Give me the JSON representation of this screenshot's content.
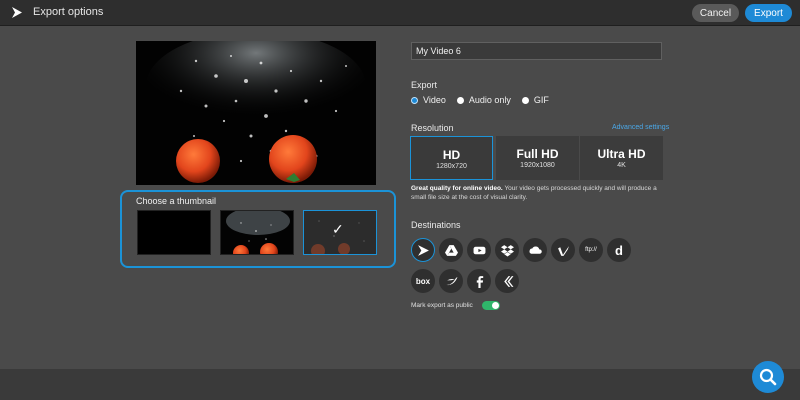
{
  "header": {
    "title": "Export options",
    "cancel_label": "Cancel",
    "export_label": "Export"
  },
  "thumbnails": {
    "title": "Choose a thumbnail",
    "selected_index": 2
  },
  "video_name": {
    "value": "My Video 6"
  },
  "export": {
    "label": "Export",
    "options": [
      "Video",
      "Audio only",
      "GIF"
    ],
    "selected": "Video"
  },
  "resolution": {
    "label": "Resolution",
    "advanced_link": "Advanced settings",
    "cards": [
      {
        "name": "HD",
        "sub": "1280x720"
      },
      {
        "name": "Full HD",
        "sub": "1920x1080"
      },
      {
        "name": "Ultra HD",
        "sub": "4K"
      }
    ],
    "selected": "HD",
    "description_bold": "Great quality for online video.",
    "description_rest": " Your video gets processed quickly and will produce a small file size at the cost of visual clarity."
  },
  "destinations": {
    "label": "Destinations",
    "items": [
      "wevideo-icon",
      "google-drive-icon",
      "youtube-icon",
      "dropbox-icon",
      "onedrive-icon",
      "vimeo-icon",
      "ftp-icon",
      "dailymotion-icon",
      "box-icon",
      "twitter-icon",
      "facebook-icon",
      "schoology-icon"
    ],
    "ftp_text": "ftp://",
    "box_text": "box",
    "dailymotion_text": "d",
    "selected": "wevideo-icon"
  },
  "public": {
    "label": "Mark export as public",
    "enabled": true
  },
  "colors": {
    "accent": "#1e8ad6",
    "toggle_on": "#2fb56a",
    "tomato": "#e2451c"
  }
}
